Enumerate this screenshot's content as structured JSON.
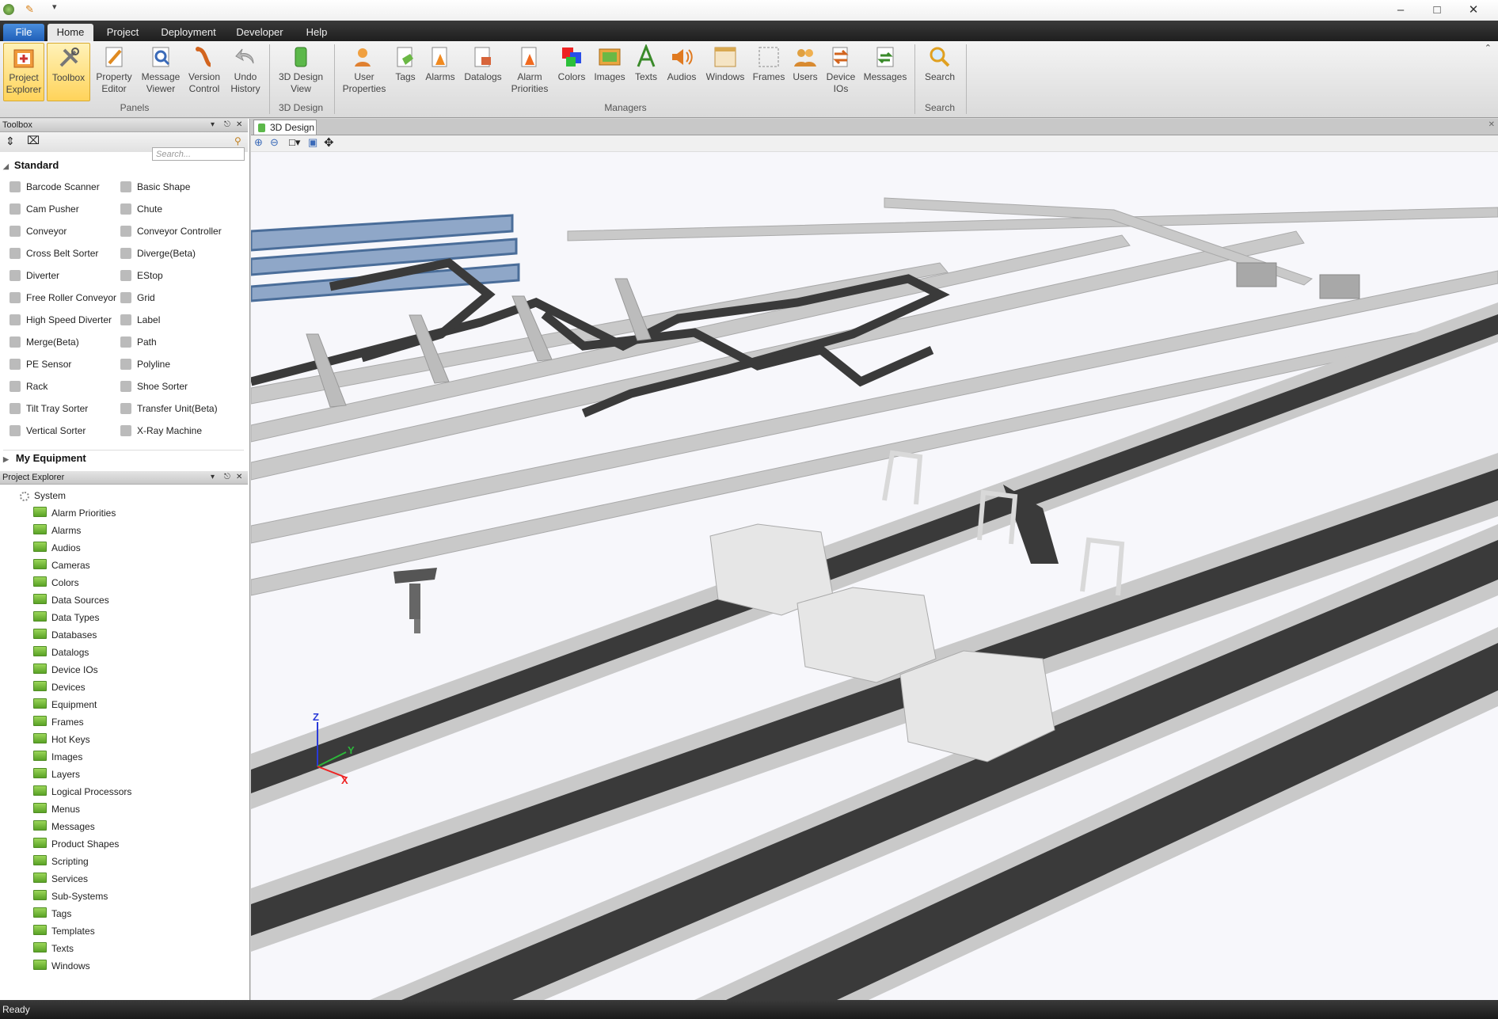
{
  "menu": {
    "file": "File",
    "home": "Home",
    "project": "Project",
    "deployment": "Deployment",
    "developer": "Developer",
    "help": "Help"
  },
  "ribbon": {
    "panels": {
      "label": "Panels",
      "project_explorer": "Project Explorer",
      "toolbox": "Toolbox",
      "property_editor": "Property Editor",
      "message_viewer": "Message Viewer",
      "version_control": "Version Control",
      "undo_history": "Undo History"
    },
    "design": {
      "label": "3D Design",
      "view": "3D Design View"
    },
    "managers": {
      "label": "Managers",
      "user_properties": "User Properties",
      "tags": "Tags",
      "alarms": "Alarms",
      "datalogs": "Datalogs",
      "alarm_priorities": "Alarm Priorities",
      "colors": "Colors",
      "images": "Images",
      "texts": "Texts",
      "audios": "Audios",
      "windows": "Windows",
      "frames": "Frames",
      "users": "Users",
      "device_ios": "Device IOs",
      "messages": "Messages"
    },
    "search": {
      "label": "Search",
      "button": "Search"
    }
  },
  "toolbox": {
    "title": "Toolbox",
    "search_placeholder": "Search...",
    "standard": "Standard",
    "items_left": [
      "Barcode Scanner",
      "Cam Pusher",
      "Conveyor",
      "Cross Belt Sorter",
      "Diverter",
      "Free Roller Conveyor",
      "High Speed Diverter",
      "Merge(Beta)",
      "PE Sensor",
      "Rack",
      "Tilt Tray Sorter",
      "Vertical Sorter"
    ],
    "items_right": [
      "Basic Shape",
      "Chute",
      "Conveyor Controller",
      "Diverge(Beta)",
      "EStop",
      "Grid",
      "Label",
      "Path",
      "Polyline",
      "Shoe Sorter",
      "Transfer Unit(Beta)",
      "X-Ray Machine"
    ],
    "my_equipment": "My Equipment"
  },
  "explorer": {
    "title": "Project Explorer",
    "root": "System",
    "items": [
      "Alarm Priorities",
      "Alarms",
      "Audios",
      "Cameras",
      "Colors",
      "Data Sources",
      "Data Types",
      "Databases",
      "Datalogs",
      "Device IOs",
      "Devices",
      "Equipment",
      "Frames",
      "Hot Keys",
      "Images",
      "Layers",
      "Logical Processors",
      "Menus",
      "Messages",
      "Product Shapes",
      "Scripting",
      "Services",
      "Sub-Systems",
      "Tags",
      "Templates",
      "Texts",
      "Windows"
    ]
  },
  "document": {
    "tab": "3D Design"
  },
  "axes": {
    "z": "Z",
    "y": "Y",
    "x": "X"
  },
  "status": {
    "text": "Ready"
  },
  "colors": {
    "accent": "#1f5fb8",
    "belt": "#3a3a3a",
    "frame": "#c9c9c9",
    "rack": "#4a6d99"
  }
}
